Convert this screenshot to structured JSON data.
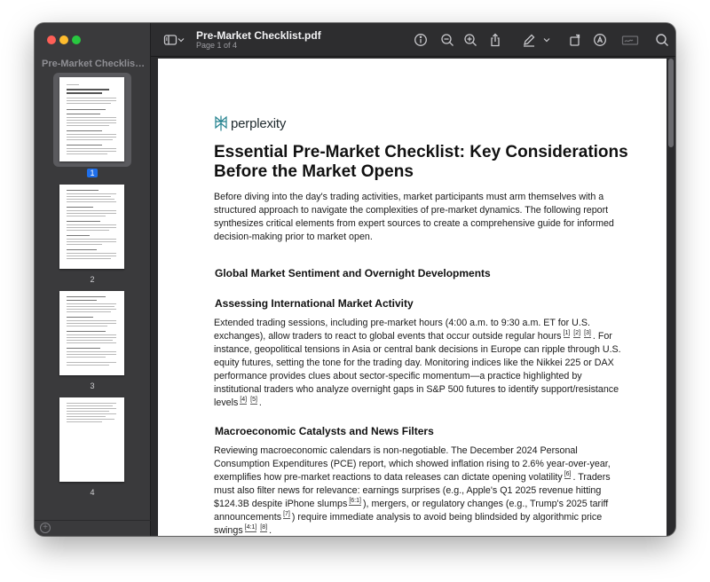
{
  "window": {
    "doc_title": "Pre-Market Checklist.pdf",
    "page_indicator": "Page 1 of 4"
  },
  "sidebar": {
    "title": "Pre-Market Checklist....",
    "thumbnails": [
      {
        "label": "1"
      },
      {
        "label": "2"
      },
      {
        "label": "3"
      },
      {
        "label": "4"
      }
    ]
  },
  "toolbar": {
    "icons": [
      "sidebar-toggle-icon",
      "chevron-down-icon",
      "info-icon",
      "zoom-out-icon",
      "zoom-in-icon",
      "share-icon",
      "markup-pen-icon",
      "chevron-down-icon",
      "rotate-icon",
      "annotate-icon",
      "signature-icon",
      "search-icon"
    ]
  },
  "document": {
    "logo_text": "perplexity",
    "title": "Essential Pre-Market Checklist: Key Considerations Before the Market Opens",
    "intro": "Before diving into the day's trading activities, market participants must arm themselves with a structured approach to navigate the complexities of pre-market dynamics. The following report synthesizes critical elements from expert sources to create a comprehensive guide for informed decision-making prior to market open.",
    "section1_heading": "Global Market Sentiment and Overnight Developments",
    "sub1_heading": "Assessing International Market Activity",
    "sub1_p_a": "Extended trading sessions, including pre-market hours (4:00 a.m. to 9:30 a.m. ET for U.S. exchanges), allow traders to react to global events that occur outside regular hours",
    "sub1_refs_a": [
      "[1]",
      "[2]",
      "[3]"
    ],
    "sub1_p_b": ". For instance, geopolitical tensions in Asia or central bank decisions in Europe can ripple through U.S. equity futures, setting the tone for the trading day. Monitoring indices like the Nikkei 225 or DAX performance provides clues about sector-specific momentum—a practice highlighted by institutional traders who analyze overnight gaps in S&P 500 futures to identify support/resistance levels",
    "sub1_refs_b": [
      "[4]",
      "[5]"
    ],
    "sub1_p_c": ".",
    "sub2_heading": "Macroeconomic Catalysts and News Filters",
    "sub2_p_a": "Reviewing macroeconomic calendars is non-negotiable. The December 2024 Personal Consumption Expenditures (PCE) report, which showed inflation rising to 2.6% year-over-year, exemplifies how pre-market reactions to data releases can dictate opening volatility",
    "sub2_ref_a": "[6]",
    "sub2_p_b": ". Traders must also filter news for relevance: earnings surprises (e.g., Apple's Q1 2025 revenue hitting $124.3B despite iPhone slumps",
    "sub2_ref_b": "[6:1]",
    "sub2_p_c": "), mergers, or regulatory changes (e.g., Trump's 2025 tariff announcements",
    "sub2_ref_c": "[7]",
    "sub2_p_d": ") require immediate analysis to avoid being blindsided by algorithmic price swings",
    "sub2_refs_d": [
      "[4:1]",
      "[8]"
    ],
    "sub2_p_e": "."
  }
}
